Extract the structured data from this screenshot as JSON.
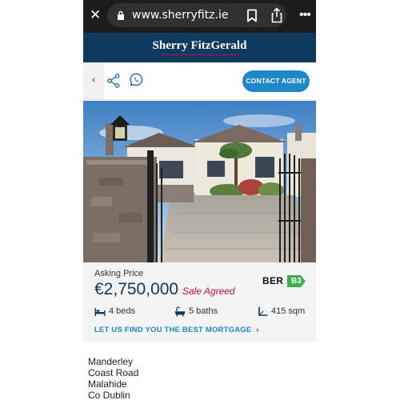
{
  "browser": {
    "close_glyph": "✕",
    "url": "www.sherryfitz.ie",
    "more_glyph": "•••"
  },
  "brand": {
    "logo_text": "Sherry FitzGerald",
    "color_navy": "#0e3a60",
    "color_red": "#c8102e"
  },
  "actions": {
    "back_glyph": "‹",
    "contact_label": "CONTACT AGENT",
    "accent": "#1e88c9"
  },
  "listing": {
    "asking_label": "Asking Price",
    "price": "€2,750,000",
    "status": "Sale Agreed",
    "ber_label": "BER",
    "ber_rating": "B3",
    "ber_color": "#3fae49",
    "beds": "4 beds",
    "baths": "5 baths",
    "area": "415 sqm",
    "mortgage_cta": "LET US FIND YOU THE BEST MORTGAGE",
    "mortgage_chevron": "›"
  },
  "address": {
    "lines": [
      "Manderley",
      "Coast Road",
      "Malahide",
      "Co Dublin"
    ]
  },
  "icons": {
    "lock": "lock-icon",
    "bookmark": "bookmark-icon",
    "share": "share-icon",
    "whatsapp": "whatsapp-icon",
    "bed": "bed-icon",
    "bath": "bath-icon",
    "area": "area-icon"
  }
}
